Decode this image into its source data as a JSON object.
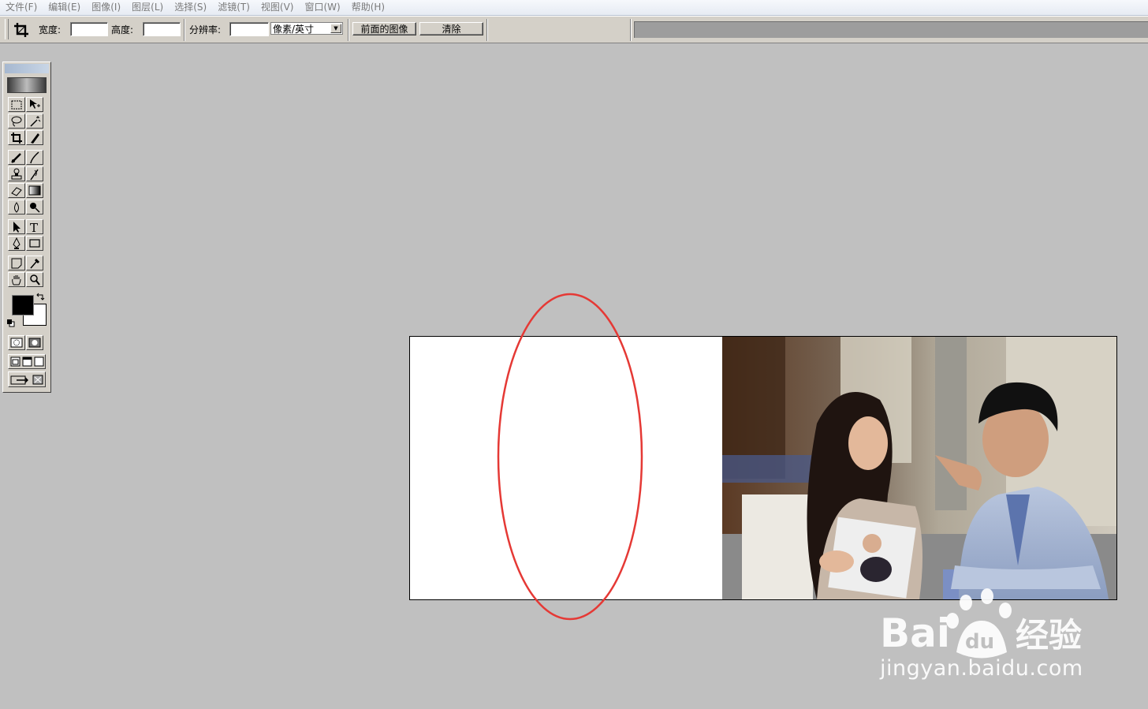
{
  "menu": [
    {
      "label": "文件(F)"
    },
    {
      "label": "编辑(E)"
    },
    {
      "label": "图像(I)"
    },
    {
      "label": "图层(L)"
    },
    {
      "label": "选择(S)"
    },
    {
      "label": "滤镜(T)"
    },
    {
      "label": "视图(V)"
    },
    {
      "label": "窗口(W)"
    },
    {
      "label": "帮助(H)"
    }
  ],
  "options": {
    "width_label": "宽度:",
    "width_value": "",
    "height_label": "高度:",
    "height_value": "",
    "resolution_label": "分辨率:",
    "resolution_value": "",
    "unit_selected": "像素/英寸",
    "front_image_button": "前面的图像",
    "clear_button": "清除"
  },
  "canvas": {
    "annotation_color": "#e53935"
  },
  "watermark": {
    "logo_text": "Bai du 经验",
    "url": "jingyan.baidu.com"
  },
  "icons": [
    "crop-icon",
    "marquee-icon",
    "move-icon",
    "lasso-icon",
    "magic-wand-icon",
    "crop-tool-icon",
    "slice-icon",
    "healing-brush-icon",
    "brush-icon",
    "stamp-icon",
    "history-brush-icon",
    "eraser-icon",
    "gradient-icon",
    "blur-icon",
    "dodge-icon",
    "path-select-icon",
    "type-icon",
    "pen-icon",
    "shape-icon",
    "notes-icon",
    "eyedropper-icon",
    "hand-icon",
    "zoom-icon",
    "swap-colors-icon",
    "default-colors-icon",
    "standard-mode-icon",
    "quickmask-mode-icon",
    "screen-mode-icon",
    "jump-to-imageready-icon"
  ]
}
